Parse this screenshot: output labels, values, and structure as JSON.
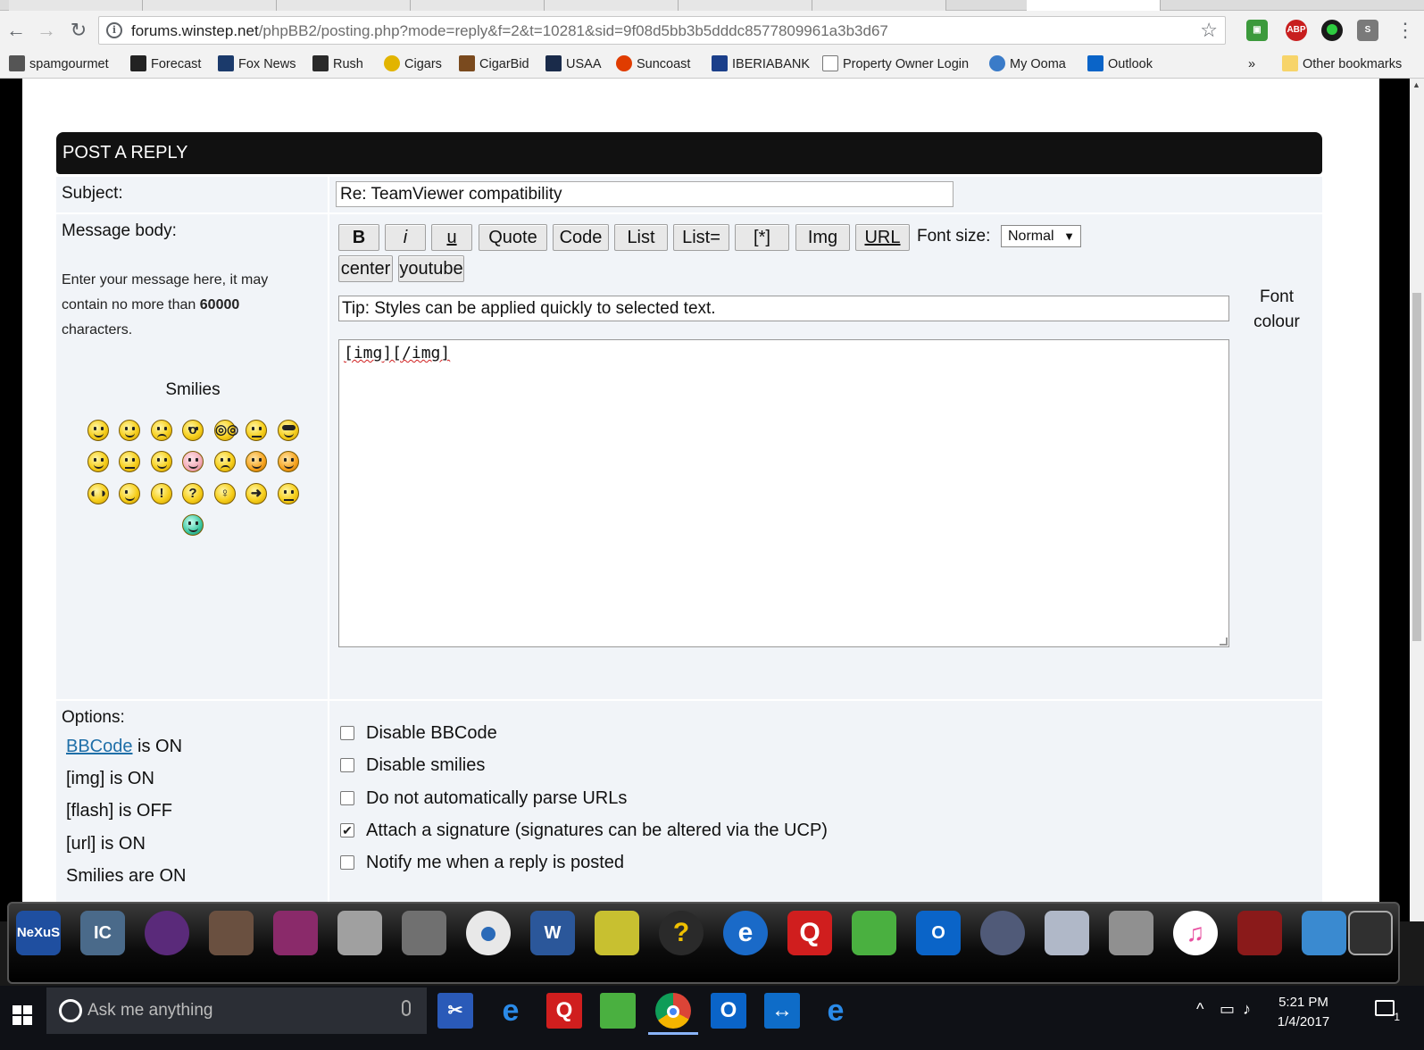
{
  "browser": {
    "url_host": "forums.winstep.net",
    "url_path": "/phpBB2/posting.php?mode=reply&f=2&t=10281&sid=9f08d5bb3b5dddc8577809961a3b3d67",
    "bookmarks": [
      {
        "label": "spamgourmet",
        "icon_color": "#444"
      },
      {
        "label": "Forecast",
        "icon_color": "#222"
      },
      {
        "label": "Fox News",
        "icon_color": "#1b3a6b"
      },
      {
        "label": "Rush",
        "icon_color": "#2a2a2a"
      },
      {
        "label": "Cigars",
        "icon_color": "#e2b400"
      },
      {
        "label": "CigarBid",
        "icon_color": "#7a4a1e"
      },
      {
        "label": "USAA",
        "icon_color": "#1a2b4a"
      },
      {
        "label": "Suncoast",
        "icon_color": "#e03c00"
      },
      {
        "label": "IBERIABANK",
        "icon_color": "#1b3f8a"
      },
      {
        "label": "Property Owner Login",
        "icon_color": "#ffffff"
      },
      {
        "label": "My Ooma",
        "icon_color": "#3a7bc8"
      },
      {
        "label": "Outlook",
        "icon_color": "#0a64c8"
      }
    ],
    "overflow_label": "»",
    "other_bookmarks": "Other bookmarks",
    "extensions": [
      {
        "name": "adblock-icon",
        "label": "ABP",
        "color": "#c81e1e"
      }
    ]
  },
  "post": {
    "header": "POST A REPLY",
    "subject_label": "Subject:",
    "subject_value": "Re: TeamViewer compatibility",
    "message_label": "Message body:",
    "help_before": "Enter your message here, it may contain no more than ",
    "help_limit": "60000",
    "help_after": " characters.",
    "smilies_title": "Smilies",
    "format_buttons": [
      "B",
      "i",
      "u",
      "Quote",
      "Code",
      "List",
      "List=",
      "[*]",
      "Img",
      "URL"
    ],
    "font_size_label": "Font size:",
    "font_size_value": "Normal",
    "row2_buttons": [
      "center",
      "youtube"
    ],
    "tip": "Tip: Styles can be applied quickly to selected text.",
    "font_colour_label": "Font colour",
    "message_text": "[img][/img]"
  },
  "options": {
    "title": "Options:",
    "bbcode_link": "BBCode",
    "bbcode_state": " is ON",
    "img_state": "[img] is ON",
    "flash_state": "[flash] is OFF",
    "url_state": "[url] is ON",
    "smilies_state": "Smilies are ON",
    "checkboxes": [
      {
        "label": "Disable BBCode",
        "checked": false
      },
      {
        "label": "Disable smilies",
        "checked": false
      },
      {
        "label": "Do not automatically parse URLs",
        "checked": false
      },
      {
        "label": "Attach a signature (signatures can be altered via the UCP)",
        "checked": true
      },
      {
        "label": "Notify me when a reply is posted",
        "checked": false
      }
    ]
  },
  "dock": {
    "items": [
      {
        "name": "nexus",
        "label": "NeXuS",
        "color": "#1f4fa0"
      },
      {
        "name": "ic-realtime",
        "label": "IC",
        "color": "#4a6a8a"
      },
      {
        "name": "orb",
        "label": "",
        "color": "#5a2a7a"
      },
      {
        "name": "computer",
        "label": "",
        "color": "#6a5040"
      },
      {
        "name": "winrar",
        "label": "",
        "color": "#8a2a6a"
      },
      {
        "name": "drives",
        "label": "",
        "color": "#a0a0a0"
      },
      {
        "name": "metal-box",
        "label": "",
        "color": "#707070"
      },
      {
        "name": "eyeball",
        "label": "",
        "color": "#e8e8e8"
      },
      {
        "name": "word",
        "label": "W",
        "color": "#2b579a"
      },
      {
        "name": "picasa",
        "label": "",
        "color": "#c8c030"
      },
      {
        "name": "help",
        "label": "?",
        "color": "#2a2a2a"
      },
      {
        "name": "internet-explorer",
        "label": "e",
        "color": "#1a6ac8"
      },
      {
        "name": "quicken",
        "label": "Q",
        "color": "#d01e1e"
      },
      {
        "name": "dots-game",
        "label": "",
        "color": "#4ab040"
      },
      {
        "name": "outlook",
        "label": "O",
        "color": "#0a64c8"
      },
      {
        "name": "camera",
        "label": "",
        "color": "#505a78"
      },
      {
        "name": "remove-program",
        "label": "",
        "color": "#b0b8c8"
      },
      {
        "name": "tools",
        "label": "",
        "color": "#909090"
      },
      {
        "name": "itunes",
        "label": "♫",
        "color": "#e84fa0"
      },
      {
        "name": "film",
        "label": "",
        "color": "#8a1a1a"
      },
      {
        "name": "window",
        "label": "",
        "color": "#3a8ad0"
      },
      {
        "name": "monitor",
        "label": "",
        "color": "#303030"
      }
    ]
  },
  "taskbar": {
    "search_placeholder": "Ask me anything",
    "time": "5:21 PM",
    "date": "1/4/2017",
    "notification_count": "1",
    "apps": [
      {
        "name": "snipping-tool",
        "label": "✂",
        "color": "#2a5ab8"
      },
      {
        "name": "edge",
        "label": "e",
        "color": "#0f1116"
      },
      {
        "name": "quicken",
        "label": "Q",
        "color": "#d01e1e"
      },
      {
        "name": "dots-game",
        "label": "",
        "color": "#4ab040"
      },
      {
        "name": "chrome",
        "label": "",
        "color": "#0f1116"
      },
      {
        "name": "outlook",
        "label": "O",
        "color": "#0a64c8"
      },
      {
        "name": "teamviewer",
        "label": "↔",
        "color": "#0e6cc8"
      },
      {
        "name": "internet-explorer",
        "label": "e",
        "color": "#0f1116"
      }
    ]
  }
}
